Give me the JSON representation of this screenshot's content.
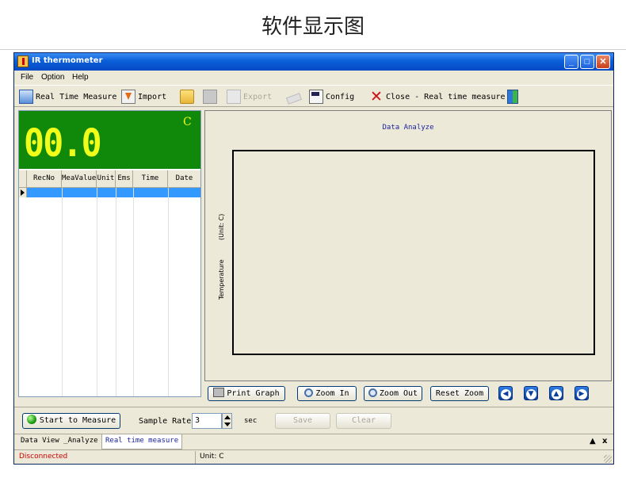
{
  "page_heading": "软件显示图",
  "window": {
    "title": "IR thermometer",
    "controls": {
      "minimize": "_",
      "maximize": "□",
      "close": "✕"
    }
  },
  "menu": {
    "items": [
      "File",
      "Option",
      "Help"
    ]
  },
  "toolbar": {
    "real_time_measure": "Real Time Measure",
    "import": "Import",
    "export": "Export",
    "config": "Config",
    "close_real_time": "Close - Real time measure",
    "icons": [
      "monitor-icon",
      "import-icon",
      "folder-icon",
      "save-icon",
      "export-icon",
      "eraser-icon",
      "config-icon",
      "close-x-icon",
      "exit-door-icon"
    ]
  },
  "display": {
    "value": "00.0",
    "unit": "C",
    "background_color": "#10880a",
    "digit_color": "#f0ff1a"
  },
  "grid": {
    "columns": [
      "RecNo",
      "MeaValue",
      "Unit",
      "Ems",
      "Time",
      "Date"
    ]
  },
  "chart": {
    "title": "Data Analyze",
    "ylabel": "Temperature",
    "ylabel_unit": "(Unit: C)",
    "buttons": {
      "print": "Print Graph",
      "zoom_in": "Zoom In",
      "zoom_out": "Zoom Out",
      "reset_zoom": "Reset Zoom"
    },
    "nav": [
      "left-arrow-icon",
      "down-arrow-icon",
      "up-arrow-icon",
      "right-arrow-icon"
    ]
  },
  "controls": {
    "start": "Start to Measure",
    "sample_rate_label": "Sample Rate",
    "sample_rate_value": "3",
    "sec_label": "sec",
    "save": "Save",
    "clear": "Clear"
  },
  "tabs": {
    "items": [
      "Data View _Analyze",
      "Real time measure"
    ],
    "active_index": 1,
    "scroll_up": "▲",
    "close": "x"
  },
  "status": {
    "connection": "Disconnected",
    "unit": "Unit: C",
    "connection_color": "#d00000"
  }
}
